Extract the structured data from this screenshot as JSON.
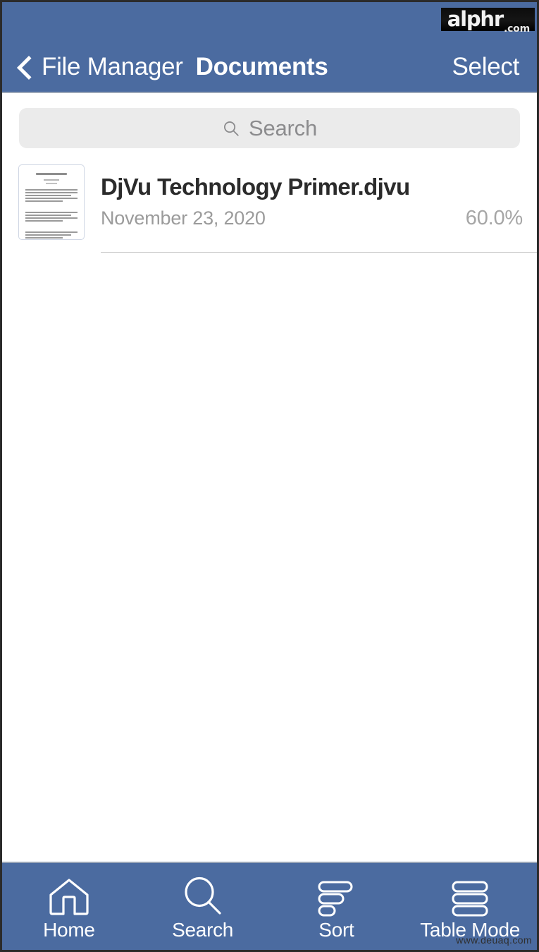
{
  "watermarks": {
    "top_main": "alphr",
    "top_tld": ".com",
    "bottom": "www.deuaq.com"
  },
  "header": {
    "back_label": "File Manager",
    "back_icon": "chevron-left-icon",
    "title": "Documents",
    "action_label": "Select",
    "background_color": "#4b6ba0",
    "text_color": "#ffffff"
  },
  "search": {
    "placeholder": "Search",
    "value": "",
    "icon": "search-icon",
    "background_color": "#ebebeb",
    "placeholder_color": "#8c8c8e"
  },
  "file_list": {
    "items": [
      {
        "name": "DjVu Technology Primer.djvu",
        "date": "November 23, 2020",
        "progress": "60.0%",
        "thumbnail": "document-page-thumbnail"
      }
    ]
  },
  "tab_bar": {
    "background_color": "#4b6ba0",
    "tabs": [
      {
        "label": "Home",
        "icon": "home-icon"
      },
      {
        "label": "Search",
        "icon": "search-icon"
      },
      {
        "label": "Sort",
        "icon": "sort-icon"
      },
      {
        "label": "Table Mode",
        "icon": "table-mode-icon"
      }
    ]
  }
}
